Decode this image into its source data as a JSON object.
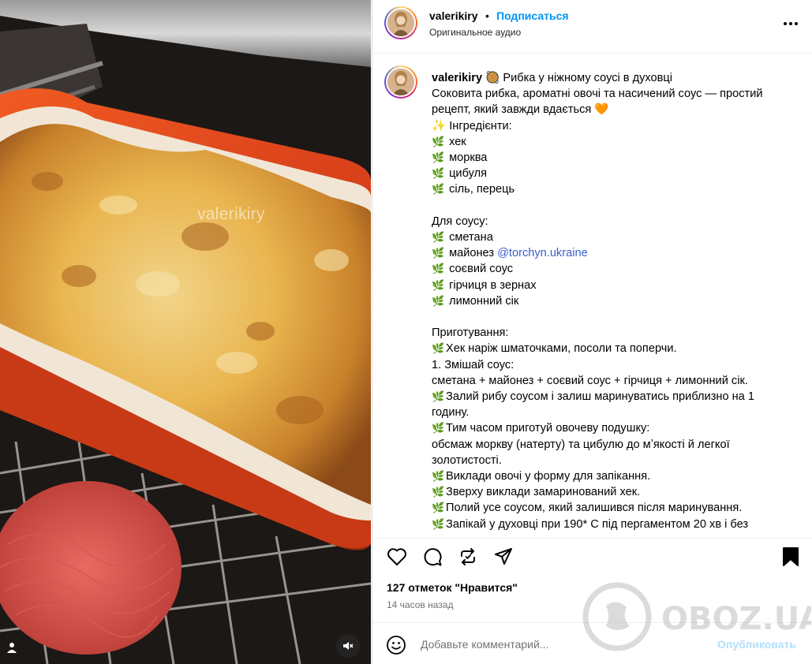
{
  "post": {
    "username": "valerikiry",
    "dot": "•",
    "follow_label": "Подписаться",
    "audio_label": "Оригинальное аудио",
    "more_icon": "more-horizontal-icon"
  },
  "media": {
    "watermark": "valerikiry"
  },
  "caption": {
    "author": "valerikiry",
    "title": "Рибка у ніжному соусі в духовці",
    "title_emoji": "🥘",
    "intro": "Соковита рибка, ароматні овочі та насичений соус — простий рецепт, який завжди вдається 🧡",
    "ingredients_header": "✨ Інгредієнти:",
    "leaf": "🌿",
    "ingredients": [
      "хек",
      "морква",
      "цибуля",
      "сіль, перець"
    ],
    "sauce_header": "Для соусу:",
    "sauce_items": [
      "сметана",
      "майонез",
      "соєвий соус",
      "гірчиця в зернах",
      "лимонний сік"
    ],
    "mention": "@torchyn.ukraine",
    "prep_header": "Приготування:",
    "step1": "Хек наріж шматочками, посоли та поперчи.",
    "step2a": "1. Змішай соус:",
    "step2b": "сметана + майонез + соєвий соус + гірчиця + лимонний сік.",
    "step3": "Залий рибу соусом і залиш маринуватись приблизно на 1 годину.",
    "step4": "Тим часом приготуй овочеву подушку:",
    "step4b": "обсмаж моркву (натерту) та цибулю до мʼякості й легкої золотистості.",
    "step5": "Виклади овочі у форму для запікання.",
    "step6": "Зверху виклади замаринований хек.",
    "step7": "Полий усе соусом, який залишився після маринування.",
    "step8": "Запікай у духовці при 190* С під пергаментом 20 хв і без"
  },
  "stats": {
    "likes": "127 отметок \"Нравится\"",
    "time": "14 часов назад"
  },
  "comment": {
    "placeholder": "Добавьте комментарий...",
    "publish_label": "Опубликовать"
  },
  "brand": {
    "logo_text": "OBOZ.UA"
  },
  "colors": {
    "accent": "#0095f6",
    "publish_disabled": "#b2dffc",
    "mention": "#3a5fcd"
  }
}
